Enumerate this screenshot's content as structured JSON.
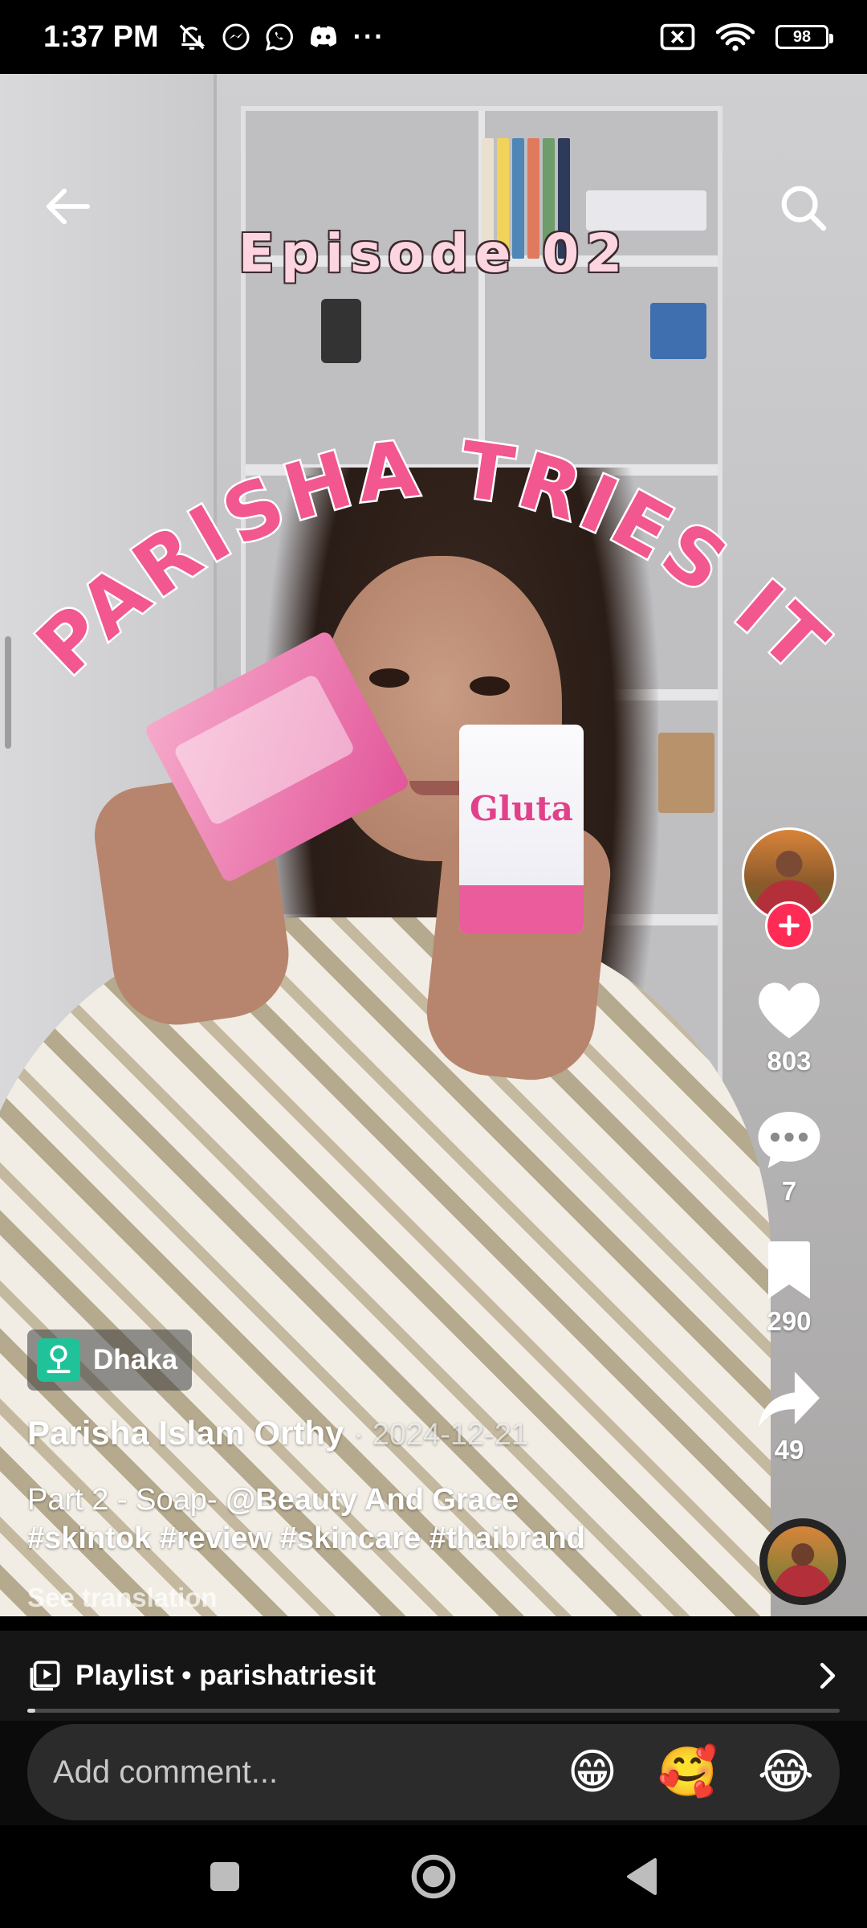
{
  "status_bar": {
    "time": "1:37 PM",
    "more": "···",
    "battery": "98"
  },
  "video": {
    "overlay": {
      "episode": "Episode 02",
      "title": "PARISHA TRIES IT"
    },
    "product_label": "Gluta"
  },
  "actions": {
    "likes": "803",
    "comments": "7",
    "saves": "290",
    "shares": "49"
  },
  "post": {
    "location": "Dhaka",
    "author": "Parisha Islam Orthy",
    "date": "· 2024-12-21",
    "caption_text": "Part 2 - Soap- ",
    "mention": "@Beauty And Grace",
    "hashtags": "#skintok #review #skincare #thaibrand",
    "see_translation": "See translation"
  },
  "playlist": {
    "label": "Playlist • parishatriesit",
    "progress": 0.01
  },
  "comment_bar": {
    "placeholder": "Add comment...",
    "emojis": [
      "😁",
      "🥰",
      "😂"
    ]
  },
  "colors": {
    "accent": "#fe2c55",
    "title_pink": "#f2578f",
    "episode_pink": "#fdd5e1",
    "location_green": "#20c29a"
  }
}
